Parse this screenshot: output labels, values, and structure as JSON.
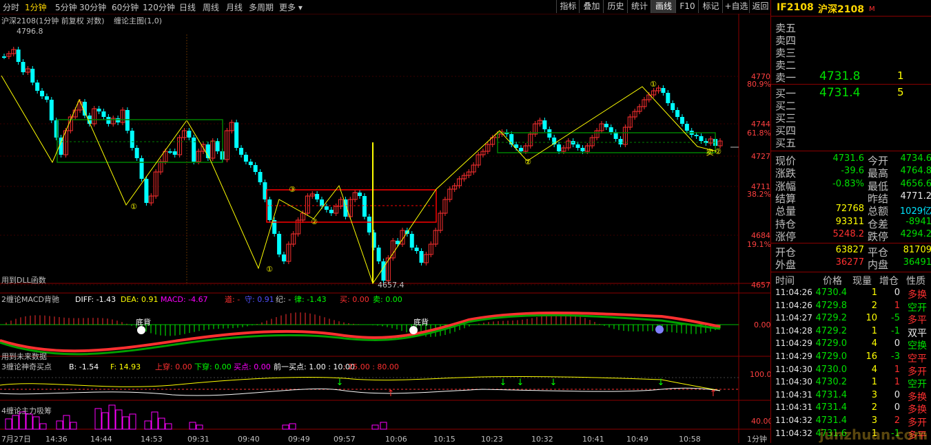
{
  "toolbar": {
    "tabs": [
      "分时",
      "1分钟",
      "5分钟",
      "30分钟",
      "60分钟",
      "120分钟",
      "日线",
      "周线",
      "月线",
      "多周期",
      "更多"
    ],
    "active_tab": "1分钟",
    "right_buttons": [
      "指标",
      "叠加",
      "历史",
      "统计",
      "画线",
      "F10",
      "标记",
      "+自选",
      "返回"
    ],
    "active_right": "画线"
  },
  "main_panel": {
    "title": "沪深2108(1分钟 前复权 对数)",
    "indicator": "缠论主图(1,0)",
    "high_label": "4796.8",
    "low_label": "4657.4",
    "note": "用到DLL函数",
    "price_ticks": [
      "4770",
      "4744",
      "4727",
      "4711",
      "4684",
      "4657"
    ],
    "pct_ticks": [
      "80.9%",
      "61.8%",
      "38.2%",
      "19.1%"
    ],
    "bottom_note": "用到未来数据",
    "sell_tag": "卖"
  },
  "macd_panel": {
    "name": "2缠论MACD背驰",
    "diff": "DIFF: -1.43",
    "dea": "DEA: 0.91",
    "macd": "MACD: -4.67",
    "dao": "道: -",
    "shou": "守: 0.91",
    "ji": "纪: -",
    "lv": "律: -1.43",
    "mai": "买: 0.00",
    "mai2": "卖: 0.00",
    "zero": "0.00",
    "bei1": "底背",
    "bei2": "底背"
  },
  "buy_panel": {
    "name": "3缠论神奇买点",
    "b": "B: -1.54",
    "f": "F: 14.93",
    "up": "上穿: 0.00",
    "down": "下穿: 0.00",
    "buy": "买点: 0.00",
    "prev": "前一买点: 1.00 : 10.00",
    "levels": ": 25.00 : 80.00",
    "tick": "100.0"
  },
  "chip_panel": {
    "name": "4缠论主力吸筹",
    "tick": "40.00"
  },
  "time_axis": [
    "7月27日",
    "14:36",
    "14:44",
    "14:53",
    "09:31",
    "09:40",
    "09:49",
    "09:57",
    "10:06",
    "10:15",
    "10:23",
    "10:32",
    "10:41",
    "10:49",
    "10:58"
  ],
  "period_label": "1分钟",
  "quote": {
    "symbol": "IF2108",
    "name": "沪深2108",
    "m": "M",
    "asks": [
      "卖五",
      "卖四",
      "卖三",
      "卖二",
      "卖一"
    ],
    "ask1_price": "4731.8",
    "ask1_vol": "1",
    "bids": [
      "买一",
      "买二",
      "买三",
      "买四",
      "买五"
    ],
    "bid1_price": "4731.4",
    "bid1_vol": "5",
    "stats": [
      {
        "k": "现价",
        "v": "4731.6",
        "c": "grn",
        "k2": "今开",
        "v2": "4734.6",
        "c2": "grn"
      },
      {
        "k": "涨跌",
        "v": "-39.6",
        "c": "grn",
        "k2": "最高",
        "v2": "4764.8",
        "c2": "grn"
      },
      {
        "k": "涨幅",
        "v": "-0.83%",
        "c": "grn",
        "k2": "最低",
        "v2": "4656.6",
        "c2": "grn"
      },
      {
        "k": "结算",
        "v": "",
        "c": "wht",
        "k2": "昨结",
        "v2": "4771.2",
        "c2": "wht"
      },
      {
        "k": "总量",
        "v": "72768",
        "c": "yel",
        "k2": "总额",
        "v2": "1029亿",
        "c2": "cyn"
      },
      {
        "k": "持仓",
        "v": "93311",
        "c": "yel",
        "k2": "仓差",
        "v2": "-8941",
        "c2": "grn"
      },
      {
        "k": "涨停",
        "v": "5248.2",
        "c": "red",
        "k2": "跌停",
        "v2": "4294.2",
        "c2": "grn"
      }
    ],
    "open_close": [
      {
        "k": "开仓",
        "v": "63827",
        "c": "yel",
        "k2": "平仓",
        "v2": "81709",
        "c2": "yel"
      },
      {
        "k": "外盘",
        "v": "36277",
        "c": "red",
        "k2": "内盘",
        "v2": "36491",
        "c2": "grn"
      }
    ],
    "trades_header": [
      "时间",
      "价格",
      "现量",
      "增仓",
      "性质"
    ],
    "trades": [
      {
        "t": "11:04:26",
        "p": "4730.4",
        "v": "1",
        "d": "0",
        "n": "多换",
        "pc": "grn",
        "dc": "wht",
        "nc": "red"
      },
      {
        "t": "11:04:26",
        "p": "4729.8",
        "v": "2",
        "d": "1",
        "n": "空开",
        "pc": "grn",
        "dc": "red",
        "nc": "grn"
      },
      {
        "t": "11:04:27",
        "p": "4729.2",
        "v": "10",
        "d": "-5",
        "n": "多平",
        "pc": "grn",
        "dc": "grn",
        "nc": "red"
      },
      {
        "t": "11:04:28",
        "p": "4729.2",
        "v": "1",
        "d": "-1",
        "n": "双平",
        "pc": "grn",
        "dc": "grn",
        "nc": "wht"
      },
      {
        "t": "11:04:29",
        "p": "4729.0",
        "v": "4",
        "d": "0",
        "n": "空换",
        "pc": "grn",
        "dc": "wht",
        "nc": "grn"
      },
      {
        "t": "11:04:29",
        "p": "4729.0",
        "v": "16",
        "d": "-3",
        "n": "空平",
        "pc": "grn",
        "dc": "grn",
        "nc": "red"
      },
      {
        "t": "11:04:30",
        "p": "4730.0",
        "v": "4",
        "d": "1",
        "n": "多开",
        "pc": "grn",
        "dc": "red",
        "nc": "red"
      },
      {
        "t": "11:04:30",
        "p": "4730.2",
        "v": "1",
        "d": "1",
        "n": "空开",
        "pc": "grn",
        "dc": "red",
        "nc": "grn"
      },
      {
        "t": "11:04:31",
        "p": "4731.4",
        "v": "3",
        "d": "0",
        "n": "多换",
        "pc": "grn",
        "dc": "wht",
        "nc": "red"
      },
      {
        "t": "11:04:31",
        "p": "4731.4",
        "v": "2",
        "d": "0",
        "n": "多换",
        "pc": "grn",
        "dc": "wht",
        "nc": "red"
      },
      {
        "t": "11:04:32",
        "p": "4731.4",
        "v": "3",
        "d": "2",
        "n": "多开",
        "pc": "grn",
        "dc": "red",
        "nc": "red"
      },
      {
        "t": "11:04:32",
        "p": "4731.6",
        "v": "1",
        "d": "-1",
        "n": "多平",
        "pc": "grn",
        "dc": "grn",
        "nc": "red"
      }
    ],
    "watermark": "junzhuan.com"
  },
  "colors": {
    "up": "#ff3030",
    "down": "#00ffff",
    "bg": "#000000",
    "green_box": "#008000",
    "red_box": "#ff0000",
    "yellow": "#ffff00"
  }
}
